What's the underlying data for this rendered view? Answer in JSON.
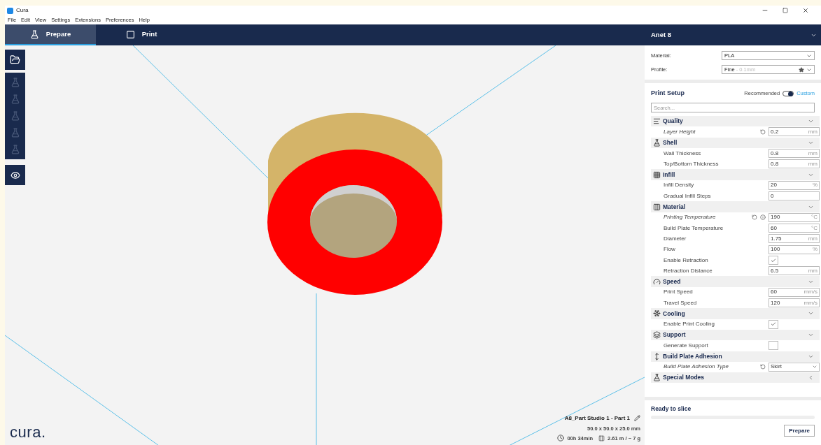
{
  "window": {
    "title": "Cura"
  },
  "menu": [
    "File",
    "Edit",
    "View",
    "Settings",
    "Extensions",
    "Preferences",
    "Help"
  ],
  "stages": [
    {
      "label": "Prepare",
      "selected": true
    },
    {
      "label": "Print",
      "selected": false
    }
  ],
  "printer": "Anet 8",
  "tools": [
    {
      "disabled": true
    },
    {
      "disabled": true
    },
    {
      "disabled": true
    },
    {
      "disabled": true
    },
    {
      "disabled": true
    }
  ],
  "material": {
    "label": "Material:",
    "value": "PLA"
  },
  "profile": {
    "label": "Profile:",
    "value": "Fine",
    "detail": "- 0.1mm"
  },
  "print_setup": {
    "title": "Print Setup",
    "modes": [
      {
        "label": "Recommended",
        "selected": false
      },
      {
        "label": "Custom",
        "selected": true
      }
    ],
    "search_placeholder": "Search..."
  },
  "settings": [
    {
      "kind": "section",
      "label": "Quality",
      "expanded": true
    },
    {
      "kind": "field",
      "label": "Layer Height",
      "value": "0.2",
      "unit": "mm",
      "modified": true,
      "info": false
    },
    {
      "kind": "section",
      "label": "Shell",
      "expanded": true
    },
    {
      "kind": "field",
      "label": "Wall Thickness",
      "value": "0.8",
      "unit": "mm",
      "modified": false,
      "info": false
    },
    {
      "kind": "field",
      "label": "Top/Bottom Thickness",
      "value": "0.8",
      "unit": "mm",
      "modified": false,
      "info": false
    },
    {
      "kind": "section",
      "label": "Infill",
      "expanded": true
    },
    {
      "kind": "field",
      "label": "Infill Density",
      "value": "20",
      "unit": "%",
      "modified": false,
      "info": false
    },
    {
      "kind": "field",
      "label": "Gradual Infill Steps",
      "value": "0",
      "modified": false,
      "info": false
    },
    {
      "kind": "section",
      "label": "Material",
      "expanded": true
    },
    {
      "kind": "field",
      "label": "Printing Temperature",
      "value": "190",
      "unit": "°C",
      "modified": true,
      "info": true
    },
    {
      "kind": "field",
      "label": "Build Plate Temperature",
      "value": "60",
      "unit": "°C",
      "modified": false,
      "info": false
    },
    {
      "kind": "field",
      "label": "Diameter",
      "value": "1.75",
      "unit": "mm",
      "modified": false,
      "info": false
    },
    {
      "kind": "field",
      "label": "Flow",
      "value": "100",
      "unit": "%",
      "modified": false,
      "info": false
    },
    {
      "kind": "checkbox",
      "label": "Enable Retraction",
      "checked": true,
      "modified": false
    },
    {
      "kind": "field",
      "label": "Retraction Distance",
      "value": "6.5",
      "unit": "mm",
      "modified": false,
      "info": false
    },
    {
      "kind": "section",
      "label": "Speed",
      "expanded": true
    },
    {
      "kind": "field",
      "label": "Print Speed",
      "value": "60",
      "unit": "mm/s",
      "modified": false,
      "info": false
    },
    {
      "kind": "field",
      "label": "Travel Speed",
      "value": "120",
      "unit": "mm/s",
      "modified": false,
      "info": false
    },
    {
      "kind": "section",
      "label": "Cooling",
      "expanded": true
    },
    {
      "kind": "checkbox",
      "label": "Enable Print Cooling",
      "checked": true,
      "modified": false
    },
    {
      "kind": "section",
      "label": "Support",
      "expanded": true
    },
    {
      "kind": "checkbox",
      "label": "Generate Support",
      "checked": false,
      "modified": false
    },
    {
      "kind": "section",
      "label": "Build Plate Adhesion",
      "expanded": true
    },
    {
      "kind": "select",
      "label": "Build Plate Adhesion Type",
      "value": "Skirt",
      "modified": true
    },
    {
      "kind": "section",
      "label": "Special Modes",
      "expanded": false
    }
  ],
  "object": {
    "name": "A8_Part Studio 1 - Part 1",
    "dimensions": "50.0 x 50.0 x 25.0 mm",
    "time": "00h 34min",
    "usage": "2.61 m / ~ 7 g"
  },
  "slice": {
    "status": "Ready to slice",
    "level": 0,
    "button": "Prepare"
  },
  "logo": "cura."
}
